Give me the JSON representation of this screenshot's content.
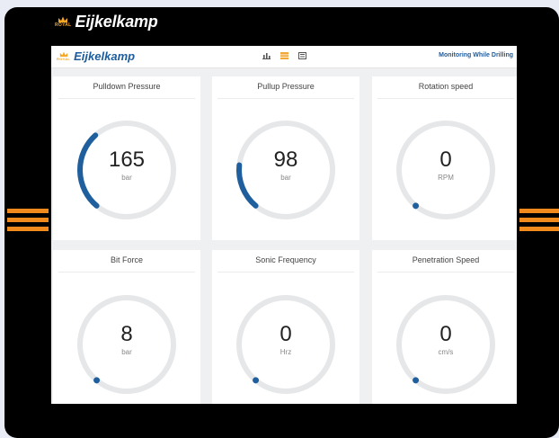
{
  "brand": {
    "royal": "ROYAL",
    "name": "Eijkelkamp",
    "accent": "#1d5c9c",
    "menu_color": "#f08a1c"
  },
  "header": {
    "title": "Monitoring While Drilling",
    "nav_icons": [
      "chart-icon",
      "grid-icon",
      "list-icon"
    ]
  },
  "gauges": [
    {
      "title": "Pulldown Pressure",
      "value": "165",
      "unit": "bar",
      "fill_fraction": 0.35
    },
    {
      "title": "Pullup Pressure",
      "value": "98",
      "unit": "bar",
      "fill_fraction": 0.2
    },
    {
      "title": "Rotation speed",
      "value": "0",
      "unit": "RPM",
      "fill_fraction": 0
    },
    {
      "title": "Bit Force",
      "value": "8",
      "unit": "bar",
      "fill_fraction": 0
    },
    {
      "title": "Sonic Frequency",
      "value": "0",
      "unit": "Hrz",
      "fill_fraction": 0
    },
    {
      "title": "Penetration Speed",
      "value": "0",
      "unit": "cm/s",
      "fill_fraction": 0
    }
  ]
}
